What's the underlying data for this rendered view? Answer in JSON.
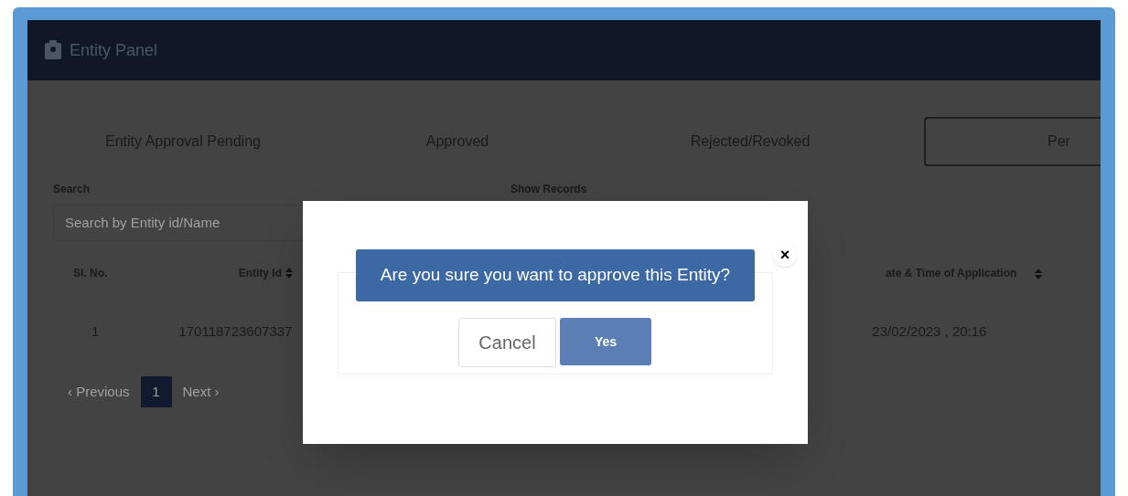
{
  "header": {
    "title": "Entity Panel"
  },
  "tabs": [
    {
      "label": "Entity Approval Pending",
      "selected": false
    },
    {
      "label": "Approved",
      "selected": false
    },
    {
      "label": "Rejected/Revoked",
      "selected": false
    },
    {
      "label": "Per",
      "selected": true
    }
  ],
  "search": {
    "label": "Search",
    "placeholder": "Search by Entity id/Name"
  },
  "show_records": {
    "label": "Show Records"
  },
  "table": {
    "columns": [
      "Sl. No.",
      "Entity Id",
      "ate & Time of Application"
    ],
    "rows": [
      {
        "sl_no": "1",
        "entity_id": "170118723607337",
        "date_time": "23/02/2023 , 20:16"
      }
    ]
  },
  "pagination": {
    "previous": "‹ Previous",
    "pages": [
      {
        "label": "1",
        "selected": true
      }
    ],
    "next": "Next ›"
  },
  "dialog": {
    "message": "Are you sure you want to approve this Entity?",
    "close": "×",
    "buttons": [
      {
        "label": "Cancel",
        "kind": "secondary"
      },
      {
        "label": "Yes",
        "kind": "primary"
      }
    ]
  }
}
